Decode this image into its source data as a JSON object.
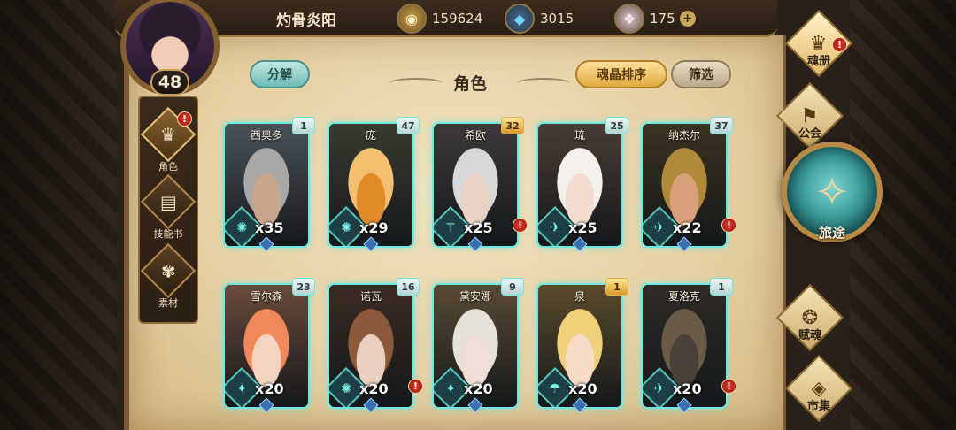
{
  "player": {
    "name": "灼骨炎阳",
    "level": "48"
  },
  "resources": {
    "gold": {
      "amount": "159624",
      "icon": "gold-coin-icon"
    },
    "crystal": {
      "amount": "3015",
      "icon": "blue-crystal-icon"
    },
    "gem": {
      "amount": "175",
      "icon": "pink-gem-icon"
    },
    "plus": "+"
  },
  "left_nav": [
    {
      "label": "角色",
      "icon": "character-icon",
      "glyph": "♛",
      "alert": "!"
    },
    {
      "label": "技能书",
      "icon": "skill-book-icon",
      "glyph": "▤"
    },
    {
      "label": "素材",
      "icon": "material-icon",
      "glyph": "✾"
    }
  ],
  "header": {
    "title": "角色",
    "decompose": "分解",
    "sort": "魂晶排序",
    "filter": "筛选"
  },
  "cards": [
    {
      "name": "西奥多",
      "stars": "1",
      "count": "x35",
      "class_glyph": "✺",
      "gold": false,
      "alert": false,
      "skin": "#c9a58c",
      "hair": "#a8a8a8",
      "bg": "#4a5258"
    },
    {
      "name": "庞",
      "stars": "47",
      "count": "x29",
      "class_glyph": "✺",
      "gold": false,
      "alert": false,
      "skin": "#e08a2a",
      "hair": "#f2c070",
      "bg": "#3a3a30"
    },
    {
      "name": "希欧",
      "stars": "32",
      "count": "x25",
      "class_glyph": "⚚",
      "gold": true,
      "alert": true,
      "skin": "#e8d2c6",
      "hair": "#d8d8d8",
      "bg": "#3c3838"
    },
    {
      "name": "琉",
      "stars": "25",
      "count": "x25",
      "class_glyph": "✈",
      "gold": false,
      "alert": false,
      "skin": "#f2ddd0",
      "hair": "#f4f0ec",
      "bg": "#4a3c34"
    },
    {
      "name": "纳杰尔",
      "stars": "37",
      "count": "x22",
      "class_glyph": "✈",
      "gold": false,
      "alert": true,
      "skin": "#d8a07a",
      "hair": "#b08a3a",
      "bg": "#3c3220"
    },
    {
      "name": "雪尔森",
      "stars": "23",
      "count": "x20",
      "class_glyph": "✦",
      "gold": false,
      "alert": false,
      "skin": "#f6d4c2",
      "hair": "#f08a5a",
      "bg": "#6a4a3a"
    },
    {
      "name": "诺瓦",
      "stars": "16",
      "count": "x20",
      "class_glyph": "✺",
      "gold": false,
      "alert": true,
      "skin": "#ead0c0",
      "hair": "#8a5a3a",
      "bg": "#3c2a22"
    },
    {
      "name": "黛安娜",
      "stars": "9",
      "count": "x20",
      "class_glyph": "✦",
      "gold": false,
      "alert": false,
      "skin": "#eee0d6",
      "hair": "#e6e2da",
      "bg": "#5a4a34"
    },
    {
      "name": "泉",
      "stars": "1",
      "count": "x20",
      "class_glyph": "☂",
      "gold": true,
      "alert": false,
      "skin": "#f6dcc6",
      "hair": "#f2cf7a",
      "bg": "#5a4a2a"
    },
    {
      "name": "夏洛克",
      "stars": "1",
      "count": "x20",
      "class_glyph": "✈",
      "gold": false,
      "alert": true,
      "skin": "#4a4038",
      "hair": "#6a5a48",
      "bg": "#2e2a26"
    }
  ],
  "right_nav": {
    "book": {
      "label": "魂册",
      "icon": "soul-book-icon",
      "glyph": "♛",
      "alert": "!"
    },
    "guild": {
      "label": "公会",
      "icon": "guild-icon",
      "glyph": "⚑"
    },
    "journey": {
      "label": "旅途",
      "icon": "journey-compass-icon",
      "glyph": "✧"
    },
    "soul": {
      "label": "赋魂",
      "icon": "soul-infuse-icon",
      "glyph": "❂"
    },
    "market": {
      "label": "市集",
      "icon": "market-icon",
      "glyph": "◈"
    }
  }
}
